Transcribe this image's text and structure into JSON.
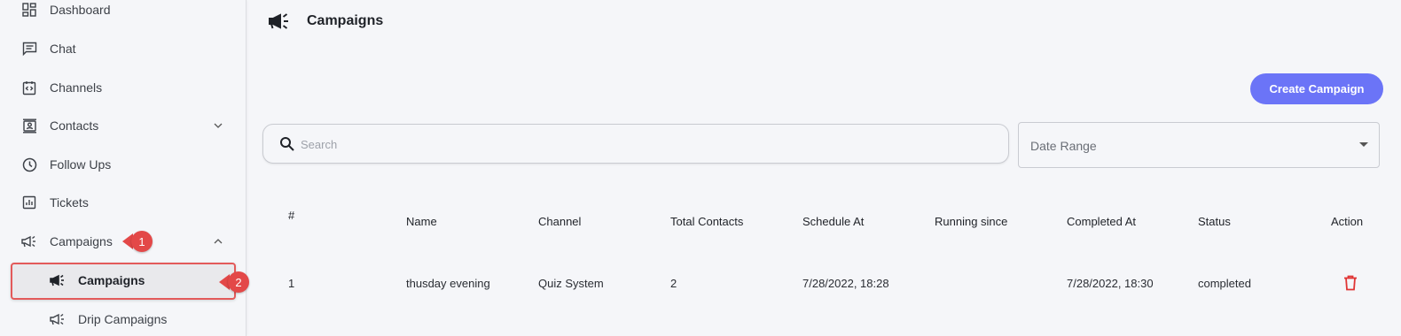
{
  "sidebar": {
    "items": [
      {
        "label": "Dashboard",
        "icon": "dashboard-icon"
      },
      {
        "label": "Chat",
        "icon": "chat-icon"
      },
      {
        "label": "Channels",
        "icon": "channels-icon"
      },
      {
        "label": "Contacts",
        "icon": "contacts-icon"
      },
      {
        "label": "Follow Ups",
        "icon": "clock-icon"
      },
      {
        "label": "Tickets",
        "icon": "tickets-icon"
      },
      {
        "label": "Campaigns",
        "icon": "megaphone-icon"
      }
    ],
    "sub_items": [
      {
        "label": "Campaigns",
        "icon": "megaphone-icon"
      },
      {
        "label": "Drip Campaigns",
        "icon": "megaphone-icon"
      }
    ]
  },
  "annotations": {
    "first": "1",
    "second": "2"
  },
  "header": {
    "title": "Campaigns",
    "icon": "megaphone-icon"
  },
  "toolbar": {
    "create_label": "Create Campaign"
  },
  "search": {
    "placeholder": "Search",
    "value": ""
  },
  "date_range": {
    "label": "Date Range"
  },
  "table": {
    "headers": [
      "#",
      "Name",
      "Channel",
      "Total Contacts",
      "Schedule At",
      "Running since",
      "Completed At",
      "Status",
      "Action"
    ],
    "rows": [
      [
        "1",
        "thusday evening",
        "Quiz System",
        "2",
        "7/28/2022, 18:28",
        "",
        "7/28/2022, 18:30",
        "completed"
      ]
    ]
  },
  "colors": {
    "accent": "#6b74f7",
    "annotation": "#e34848",
    "delete": "#e03535"
  }
}
